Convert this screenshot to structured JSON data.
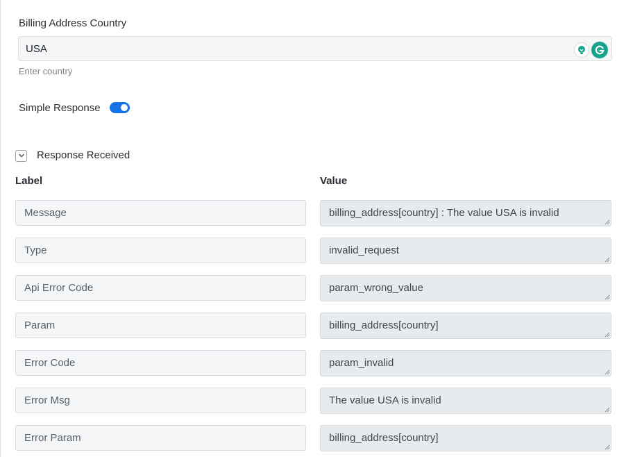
{
  "billing": {
    "label": "Billing Address Country",
    "value": "USA",
    "hint": "Enter country"
  },
  "simple_response": {
    "label": "Simple Response",
    "enabled": true
  },
  "response": {
    "title": "Response Received",
    "header_label": "Label",
    "header_value": "Value",
    "rows": [
      {
        "label": "Message",
        "value": "billing_address[country] : The value USA is invalid"
      },
      {
        "label": "Type",
        "value": "invalid_request"
      },
      {
        "label": "Api Error Code",
        "value": "param_wrong_value"
      },
      {
        "label": "Param",
        "value": "billing_address[country]"
      },
      {
        "label": "Error Code",
        "value": "param_invalid"
      },
      {
        "label": "Error Msg",
        "value": "The value USA is invalid"
      },
      {
        "label": "Error Param",
        "value": "billing_address[country]"
      }
    ]
  },
  "colors": {
    "accent": "#1473e6",
    "grammarly": "#15a38a"
  },
  "icons": [
    "lightbulb-icon",
    "grammarly-icon",
    "chevron-down-icon",
    "resize-grip-icon"
  ]
}
